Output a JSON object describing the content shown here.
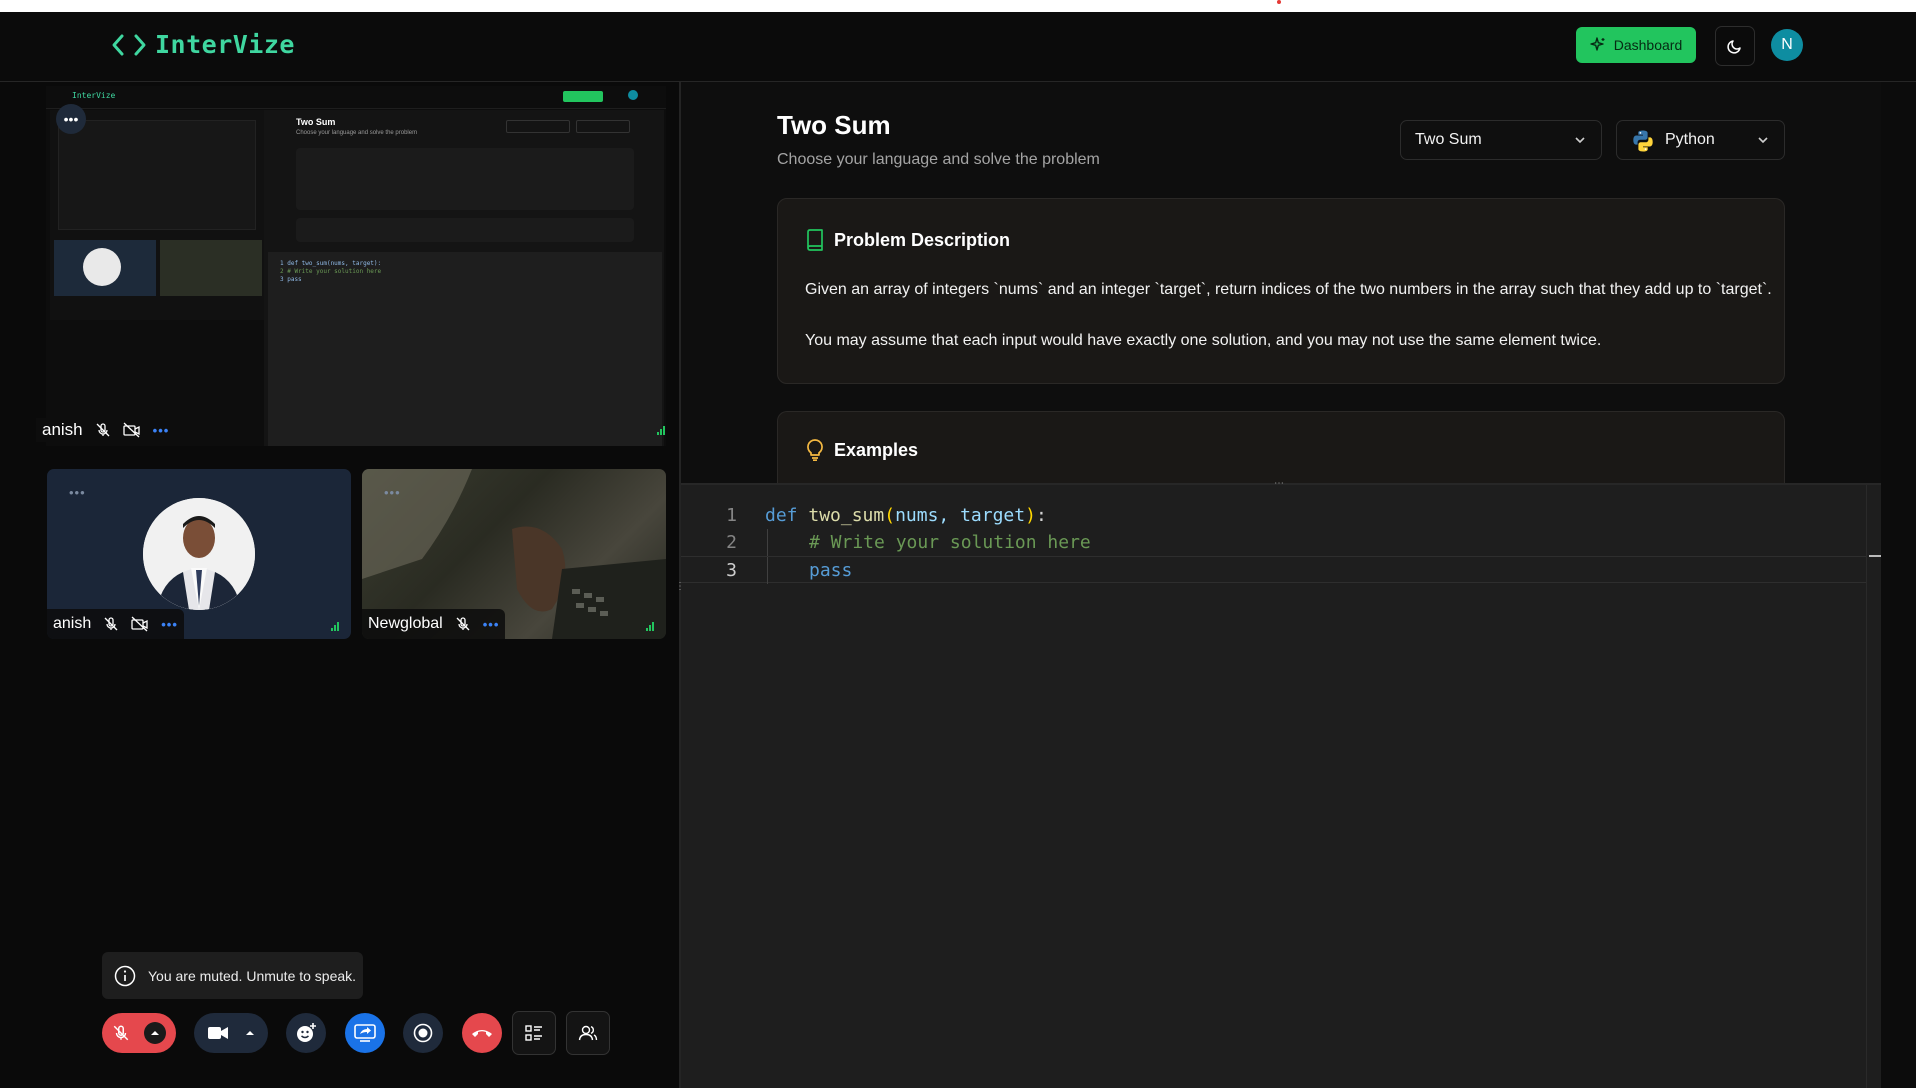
{
  "app": {
    "name": "InterVize",
    "dashboard_label": "Dashboard",
    "user_initial": "N"
  },
  "call": {
    "share_label": "anish",
    "participants": [
      {
        "name": "anish"
      },
      {
        "name": "Newglobal"
      }
    ],
    "muted_tip": "You are muted. Unmute to speak."
  },
  "problem": {
    "title": "Two Sum",
    "subtitle": "Choose your language and solve the problem",
    "selected_problem": "Two Sum",
    "selected_language": "Python",
    "description_heading": "Problem Description",
    "description_p1": "Given an array of integers `nums` and an integer `target`, return indices of the two numbers in the array such that they add up to `target`.",
    "description_p2": "You may assume that each input would have exactly one solution, and you may not use the same element twice.",
    "examples_heading": "Examples"
  },
  "editor": {
    "lines": [
      {
        "num": "1",
        "keyword": "def",
        "fname": "two_sum",
        "args": "nums, target"
      },
      {
        "num": "2",
        "comment": "# Write your solution here"
      },
      {
        "num": "3",
        "keyword": "pass"
      }
    ]
  },
  "colors": {
    "accent": "#3fd7a0",
    "dashboard": "#22c55e",
    "danger": "#e5484d",
    "share_active": "#1a73e8"
  }
}
